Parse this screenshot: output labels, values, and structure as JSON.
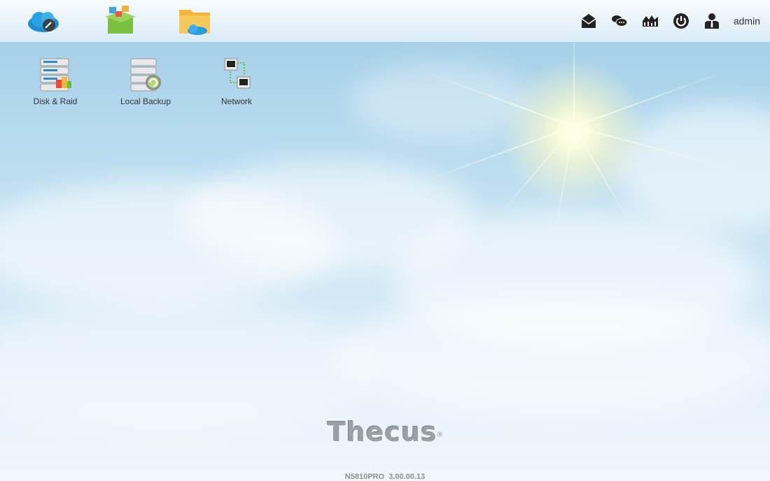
{
  "topbar": {
    "apps": [
      {
        "name": "cloud-app-icon"
      },
      {
        "name": "app-center-icon"
      },
      {
        "name": "file-center-icon"
      }
    ],
    "tools": [
      {
        "name": "mail-icon"
      },
      {
        "name": "chat-icon"
      },
      {
        "name": "monitor-icon"
      },
      {
        "name": "power-icon"
      },
      {
        "name": "user-icon"
      }
    ],
    "username": "admin"
  },
  "desktop": {
    "icons": [
      {
        "label": "Disk & Raid"
      },
      {
        "label": "Local Backup"
      },
      {
        "label": "Network"
      }
    ]
  },
  "footer": {
    "logo": "Thecus",
    "registered": "®",
    "model": "N5810PRO",
    "version": "3.00.00.13"
  }
}
